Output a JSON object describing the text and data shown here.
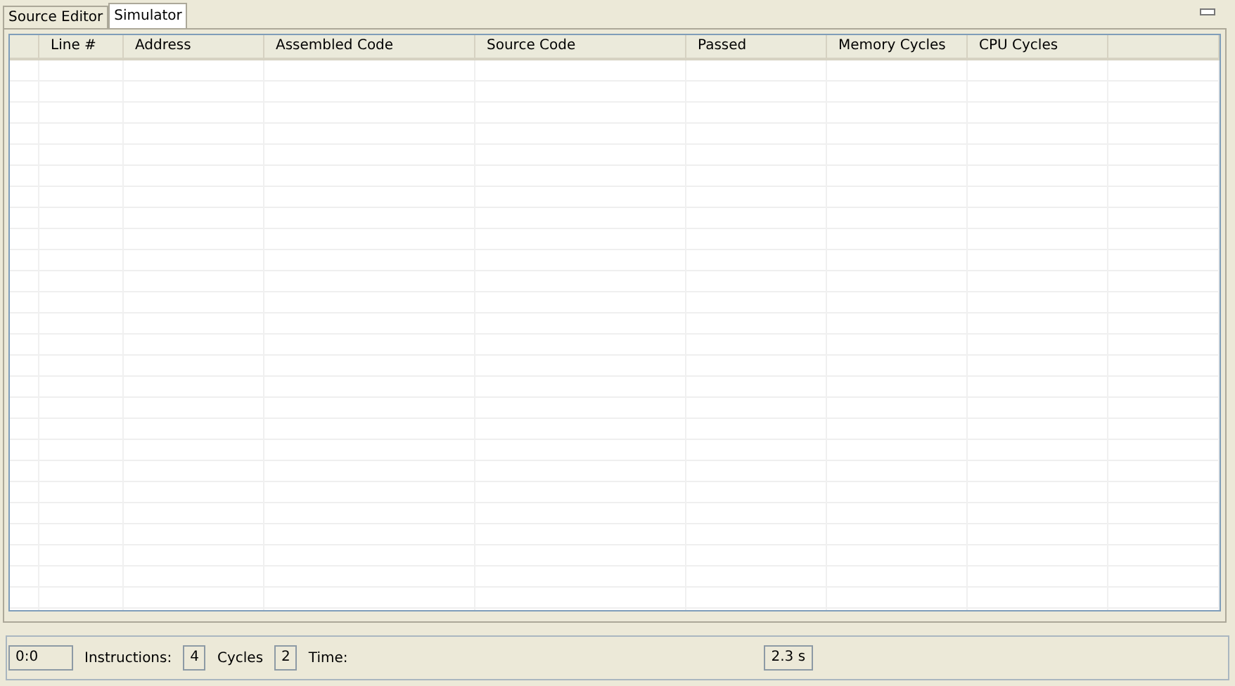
{
  "tabs": [
    {
      "label": "Source Editor",
      "selected": false
    },
    {
      "label": "Simulator",
      "selected": true
    }
  ],
  "table": {
    "columns": [
      "Line #",
      "Address",
      "Assembled Code",
      "Source Code",
      "Passed",
      "Memory Cycles",
      "CPU Cycles"
    ]
  },
  "status_bar": {
    "position": "0:0",
    "instructions_label": "Instructions:",
    "instructions": "4",
    "cycles_label": "Cycles",
    "cycles": "2",
    "time_label": "Time:",
    "time": "2.3 s"
  }
}
